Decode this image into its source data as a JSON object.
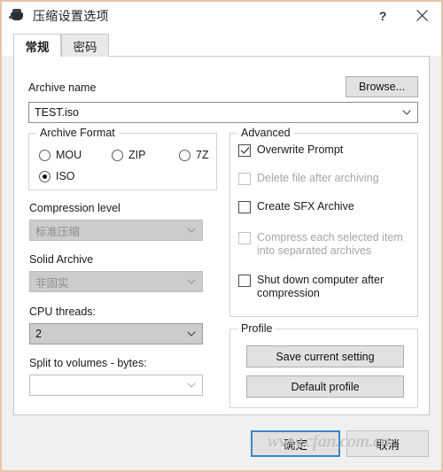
{
  "window": {
    "title": "压缩设置选项",
    "icon": "vise-icon",
    "help_label": "?",
    "close_label": "✕",
    "border_color": "#e8c5a8"
  },
  "tabs": [
    {
      "label": "常规",
      "active": true
    },
    {
      "label": "密码",
      "active": false
    }
  ],
  "general": {
    "archive_name_label": "Archive name",
    "browse_button": "Browse...",
    "archive_name_value": "TEST.iso",
    "archive_format": {
      "title": "Archive Format",
      "options": [
        {
          "label": "MOU",
          "selected": false
        },
        {
          "label": "ZIP",
          "selected": false
        },
        {
          "label": "7Z",
          "selected": false
        },
        {
          "label": "ISO",
          "selected": true
        }
      ]
    },
    "compression_level_label": "Compression level",
    "compression_level_value": "标准压缩",
    "solid_archive_label": "Solid Archive",
    "solid_archive_value": "非固实",
    "cpu_threads_label": "CPU threads:",
    "cpu_threads_value": "2",
    "split_volumes_label": "Split to volumes - bytes:",
    "split_volumes_value": ""
  },
  "advanced": {
    "title": "Advanced",
    "items": [
      {
        "label": "Overwrite Prompt",
        "checked": true,
        "disabled": false
      },
      {
        "label": "Delete file after archiving",
        "checked": false,
        "disabled": true
      },
      {
        "label": "Create SFX Archive",
        "checked": false,
        "disabled": false
      },
      {
        "label": "Compress each selected item into separated archives",
        "checked": false,
        "disabled": true
      },
      {
        "label": "Shut down computer after compression",
        "checked": false,
        "disabled": false
      }
    ]
  },
  "profile": {
    "title": "Profile",
    "save_button": "Save current setting",
    "default_button": "Default profile"
  },
  "footer": {
    "ok_label": "确定",
    "cancel_label": "取消",
    "ok_focus_color": "#3c86c8"
  },
  "watermark": "www.cfan.com.cn"
}
